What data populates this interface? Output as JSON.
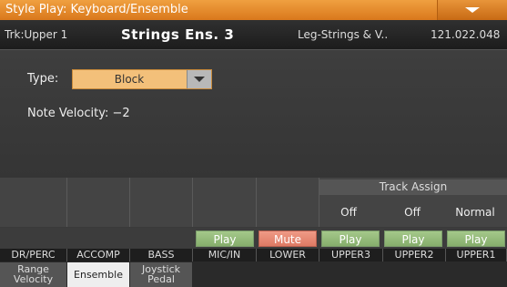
{
  "window": {
    "title": "Style Play: Keyboard/Ensemble",
    "menu_icon": "chevron-down-icon"
  },
  "track": {
    "label": "Trk:Upper 1",
    "sound_name": "Strings Ens. 3",
    "category": "Leg-Strings & V..",
    "program": "121.022.048"
  },
  "main": {
    "type_label": "Type:",
    "type_value": "Block",
    "velocity_label": "Note Velocity: −2"
  },
  "track_assign": {
    "title": "Track Assign",
    "values": [
      "Off",
      "Off",
      "Normal"
    ]
  },
  "play_buttons": [
    "Play",
    "Mute",
    "Play",
    "Play",
    "Play"
  ],
  "tracks": [
    "DR/PERC",
    "ACCOMP",
    "BASS",
    "MIC/IN",
    "LOWER",
    "UPPER3",
    "UPPER2",
    "UPPER1"
  ],
  "tabs": [
    {
      "line1": "Range",
      "line2": "Velocity"
    },
    {
      "line1": "Ensemble",
      "line2": ""
    },
    {
      "line1": "Joystick",
      "line2": "Pedal"
    }
  ],
  "colors": {
    "title_bar": "#e8892a",
    "dropdown": "#f3c07a",
    "play": "#95bc7c",
    "mute": "#e88a74"
  }
}
